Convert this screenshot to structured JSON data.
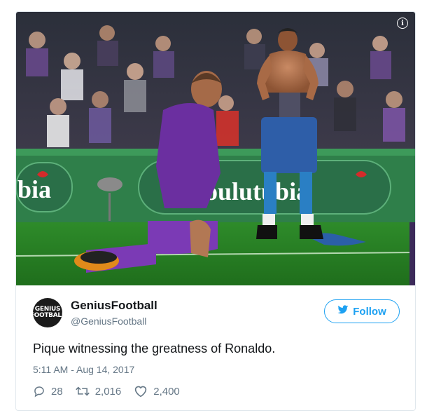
{
  "tweet": {
    "display_name": "GeniusFootball",
    "handle": "@GeniusFootball",
    "avatar_text": "GENIUS FOOTBALL",
    "follow_label": "Follow",
    "text": "Pique witnessing the greatness of Ronaldo.",
    "timestamp": "5:11 AM - Aug 14, 2017",
    "replies": "28",
    "retweets": "2,016",
    "likes": "2,400"
  },
  "media": {
    "board_text": "bia",
    "board_text_center": "ioulutubia"
  },
  "colors": {
    "accent": "#1da1f2",
    "muted": "#657786",
    "border": "#e1e8ed"
  }
}
